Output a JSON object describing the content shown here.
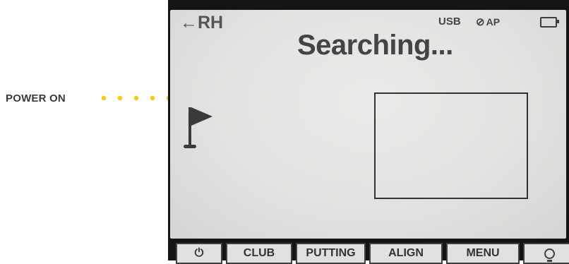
{
  "callout": {
    "label": "POWER ON"
  },
  "status_bar": {
    "back_arrow": "←",
    "hand": "RH",
    "usb": "USB",
    "wifi_off_icon": "wifi-off-icon",
    "ap": "AP",
    "battery_icon": "battery-icon"
  },
  "main": {
    "title": "Searching...",
    "flag_icon": "golf-flag-icon"
  },
  "softkeys": {
    "power": "⏻",
    "club": "CLUB",
    "putting": "PUTTING",
    "align": "ALIGN",
    "menu": "MENU",
    "light_icon": "lightbulb-icon"
  },
  "colors": {
    "dot": "#f2cc1c",
    "lcd": "#e3e5e2",
    "text": "#444444"
  }
}
